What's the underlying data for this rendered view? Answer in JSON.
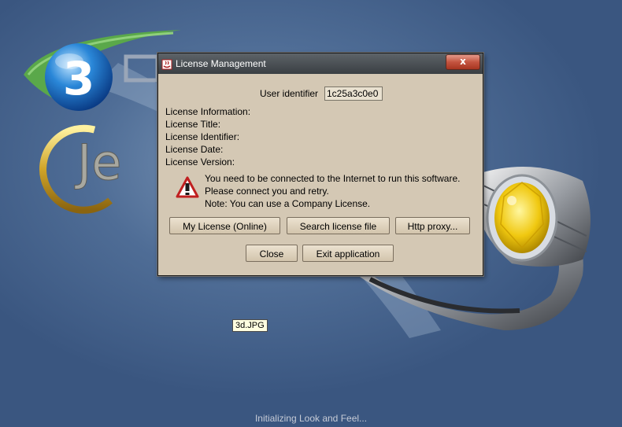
{
  "dialog": {
    "title": "License Management",
    "close_label": "x",
    "user_identifier_label": "User identifier",
    "user_identifier_value": "1c25a3c0e0",
    "info_lines": [
      "License Information:",
      "License Title:",
      "License Identifier:",
      "License Date:",
      "License Version:"
    ],
    "warning_lines": [
      "You need to be connected to the Internet to run this software.",
      "Please connect you and retry.",
      "Note: You can use a Company License."
    ],
    "buttons": {
      "my_license": "My License (Online)",
      "search_license": "Search license file",
      "http_proxy": "Http proxy...",
      "close": "Close",
      "exit": "Exit application"
    }
  },
  "tooltip": "3d.JPG",
  "status": "Initializing Look and Feel...",
  "logo_text": "Je",
  "logo_number": "3",
  "colors": {
    "background": "#3f5c86",
    "dialog_bg": "#d4c8b4",
    "swoosh": "#5aa84a",
    "gem": "#f0d020"
  }
}
